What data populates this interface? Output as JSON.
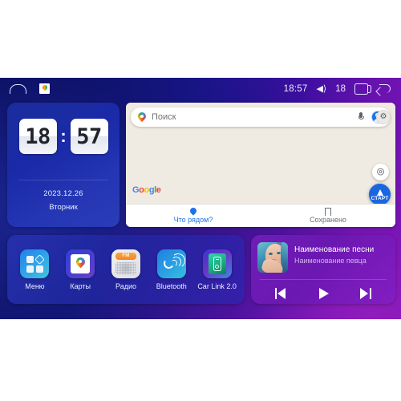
{
  "statusbar": {
    "home_icon": "home-icon",
    "maps_icon": "google-maps-icon",
    "time": "18:57",
    "volume_icon": "volume-icon",
    "volume_level": "18",
    "recents_icon": "recents-icon",
    "back_icon": "back-icon"
  },
  "clock": {
    "hours": "18",
    "colon": ":",
    "minutes": "57",
    "date": "2023.12.26",
    "weekday": "Вторник"
  },
  "map": {
    "search_placeholder": "Поиск",
    "pin_icon": "google-maps-pin-icon",
    "mic_icon": "microphone-icon",
    "avatar_icon": "account-avatar-icon",
    "gear_icon": "settings-gear-icon",
    "locate_icon": "locate-me-icon",
    "start_label": "СТАРТ",
    "google_logo": {
      "g1": "G",
      "o1": "o",
      "o2": "o",
      "g2": "g",
      "l": "l",
      "e": "e"
    },
    "tabs": [
      {
        "label": "Что рядом?",
        "icon": "location-pin-icon",
        "active": true
      },
      {
        "label": "Сохранено",
        "icon": "bookmark-icon",
        "active": false
      }
    ]
  },
  "dock": {
    "apps": [
      {
        "label": "Меню",
        "icon": "menu-grid-icon"
      },
      {
        "label": "Карты",
        "icon": "maps-icon"
      },
      {
        "label": "Радио",
        "icon": "radio-fm-icon"
      },
      {
        "label": "Bluetooth",
        "icon": "bluetooth-phone-icon"
      },
      {
        "label": "Car Link 2.0",
        "icon": "car-link-phone-icon"
      }
    ]
  },
  "music": {
    "album_art": "album-art-portrait",
    "title": "Наименование песни",
    "artist": "Наименование певца",
    "controls": [
      {
        "name": "previous-track-button",
        "icon": "skip-previous-icon"
      },
      {
        "name": "play-button",
        "icon": "play-icon"
      },
      {
        "name": "next-track-button",
        "icon": "skip-next-icon"
      }
    ]
  },
  "colors": {
    "bg_left": "#0a1060",
    "bg_right": "#7a16b8",
    "clock_panel": "#1a2aa8",
    "dock_panel": "#2834b4",
    "music_panel": "#7820be",
    "map_bg": "#efebe3",
    "accent_blue": "#1a73e8",
    "fab_blue": "#1a65e0"
  }
}
